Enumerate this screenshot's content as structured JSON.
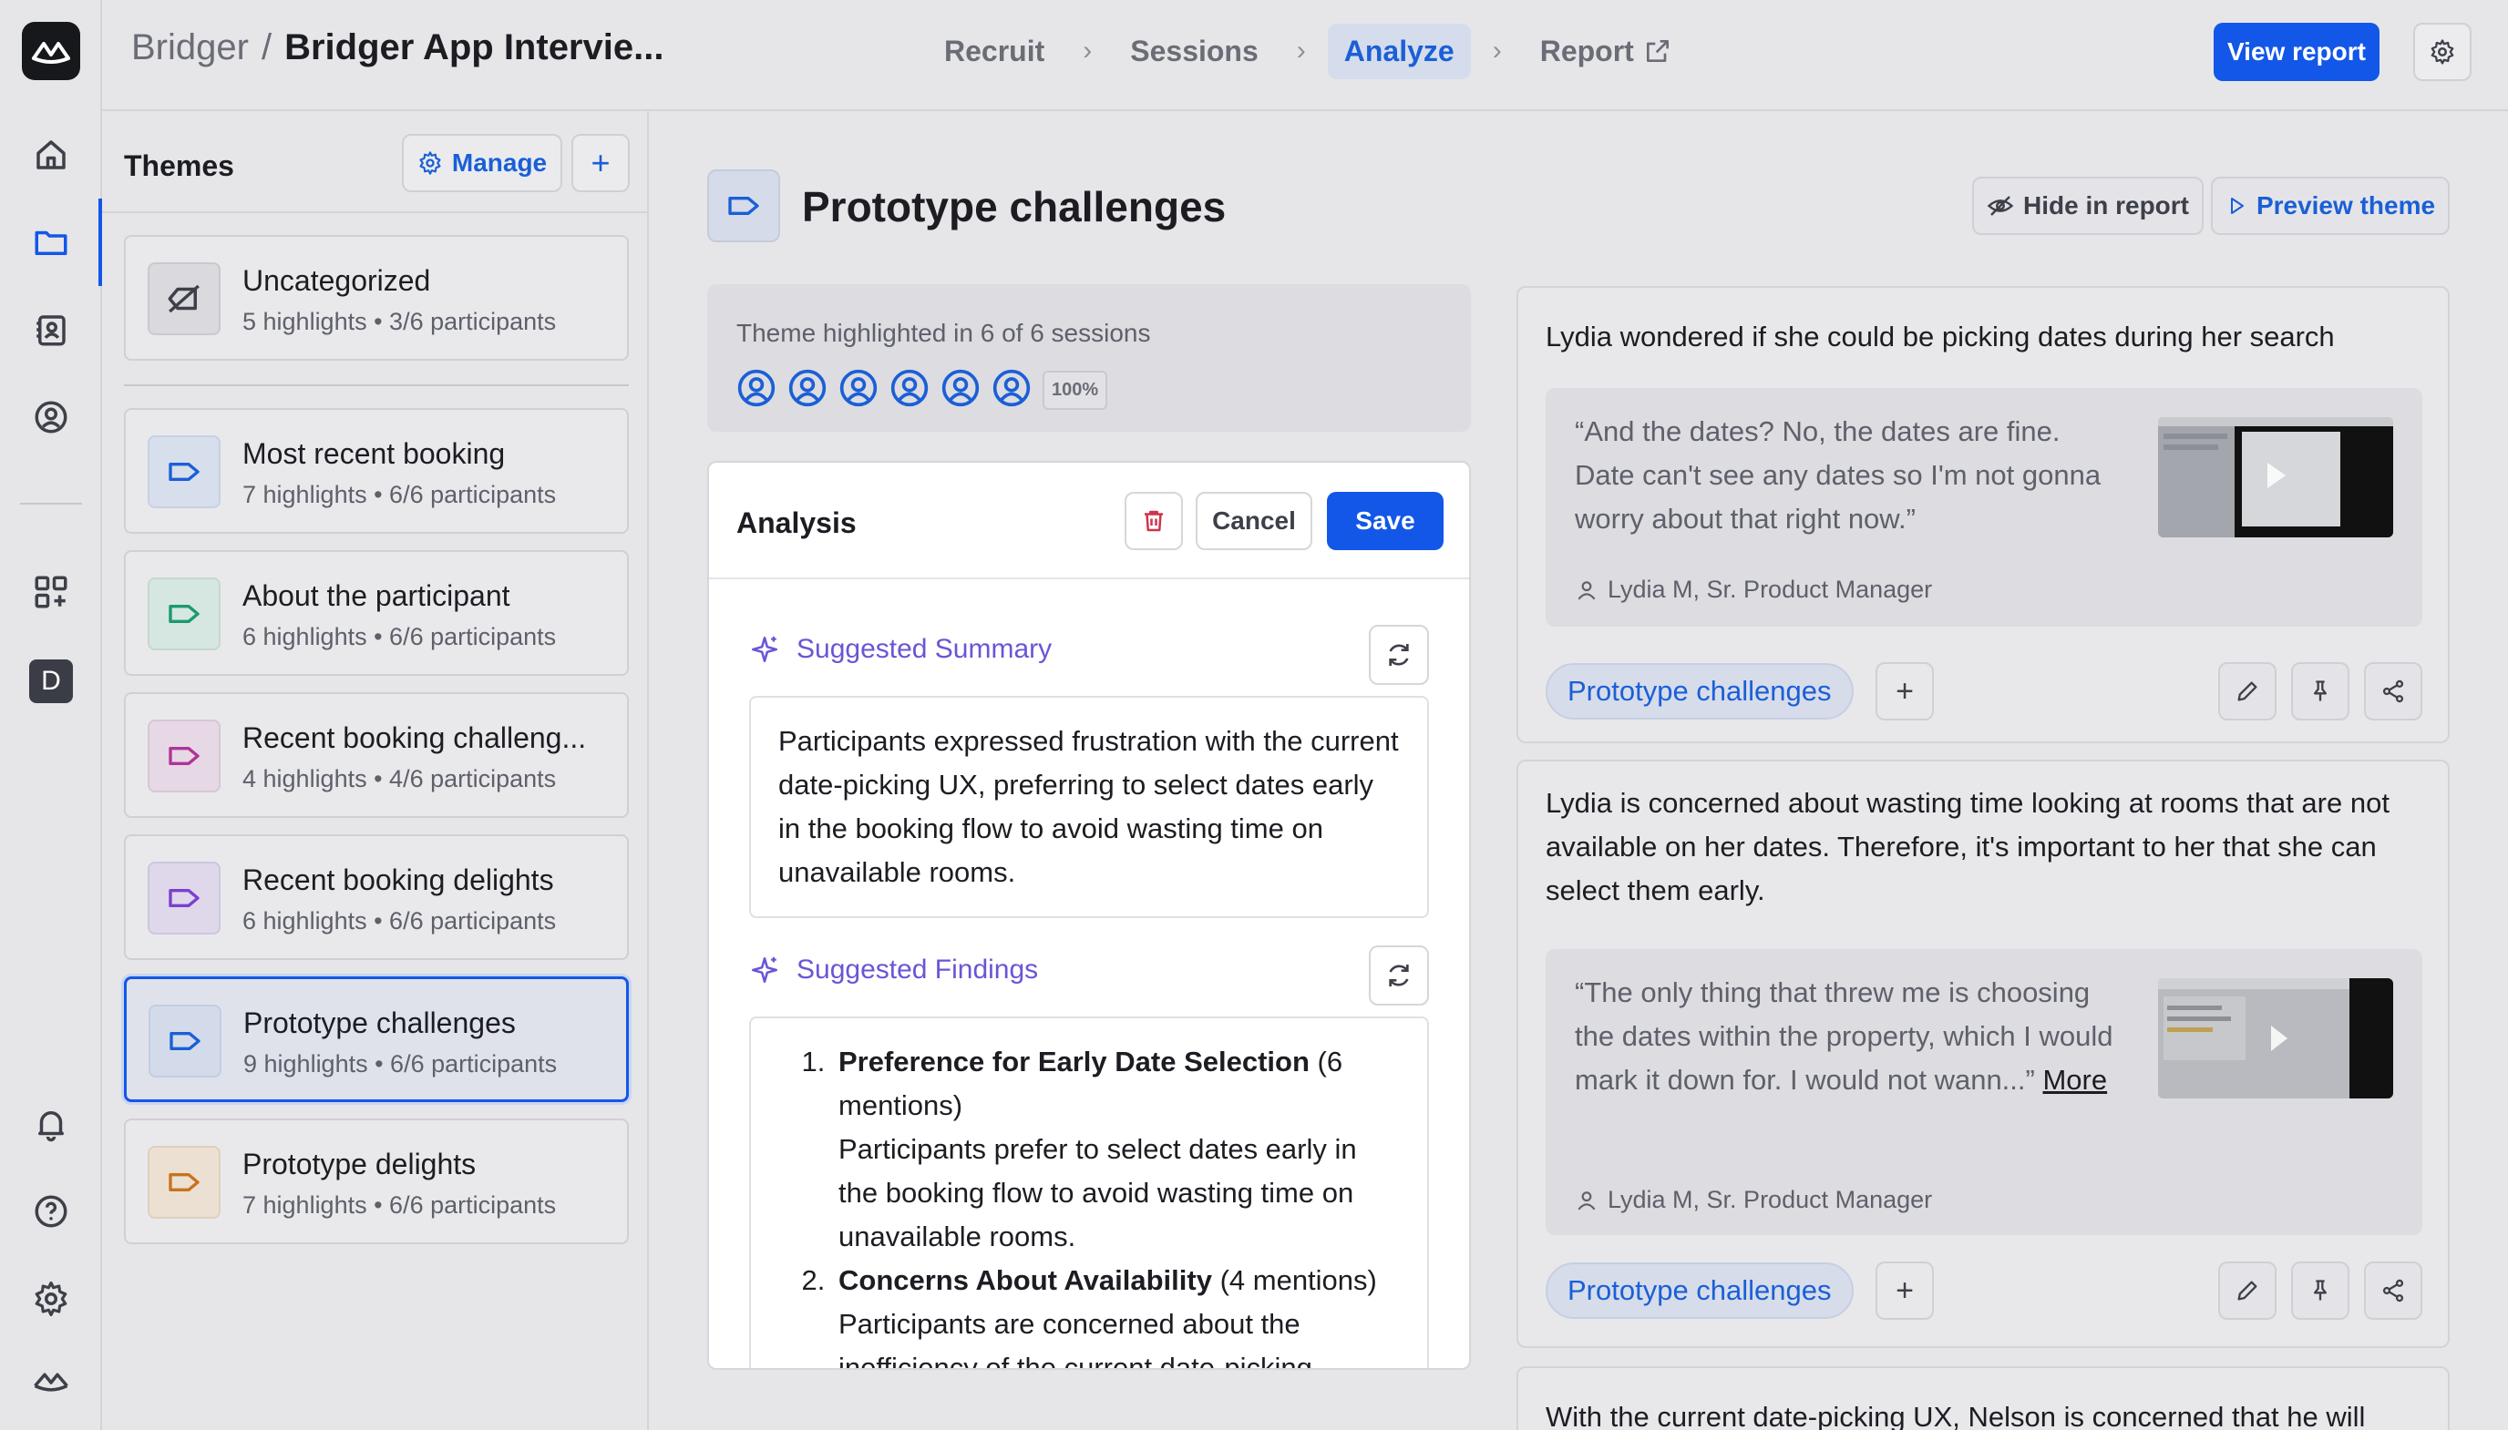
{
  "breadcrumb": {
    "project": "Bridger",
    "separator": "/",
    "current": "Bridger App Intervie..."
  },
  "steps": [
    {
      "label": "Recruit"
    },
    {
      "label": "Sessions"
    },
    {
      "label": "Analyze",
      "active": true
    },
    {
      "label": "Report"
    }
  ],
  "header": {
    "view_report": "View report"
  },
  "themes": {
    "heading": "Themes",
    "manage": "Manage",
    "add": "+",
    "items": [
      {
        "name": "Uncategorized",
        "meta": "5 highlights • 3/6 participants",
        "color": "#3e4049"
      },
      {
        "name": "Most recent booking",
        "meta": "7 highlights • 6/6 participants",
        "color": "#1a5fd6"
      },
      {
        "name": "About the participant",
        "meta": "6 highlights • 6/6 participants",
        "color": "#1a9a6e"
      },
      {
        "name": "Recent booking challeng...",
        "meta": "4 highlights • 4/6 participants",
        "color": "#b0339a"
      },
      {
        "name": "Recent booking delights",
        "meta": "6 highlights • 6/6 participants",
        "color": "#7b3fcf"
      },
      {
        "name": "Prototype challenges",
        "meta": "9 highlights • 6/6 participants",
        "color": "#1a5fd6",
        "selected": true
      },
      {
        "name": "Prototype delights",
        "meta": "7 highlights • 6/6 participants",
        "color": "#c7731c"
      }
    ]
  },
  "main": {
    "title": "Prototype challenges",
    "hide_in_report": "Hide in report",
    "preview_theme": "Preview theme",
    "sessions_text": "Theme highlighted in 6 of 6 sessions",
    "sessions_pct": "100%"
  },
  "analysis": {
    "title": "Analysis",
    "cancel": "Cancel",
    "save": "Save",
    "summary_label": "Suggested Summary",
    "summary_text": "Participants expressed frustration with the current date-picking UX, preferring to select dates early in the booking flow to avoid wasting time on unavailable rooms.",
    "findings_label": "Suggested Findings",
    "findings": [
      {
        "title": "Preference for Early Date Selection",
        "count": "(6 mentions)",
        "text": "Participants prefer to select dates early in the booking flow to avoid wasting time on unavailable rooms."
      },
      {
        "title": "Concerns About Availability",
        "count": "(4 mentions)",
        "text": "Participants are concerned about the inefficiency of the current date-picking"
      }
    ]
  },
  "highlights": [
    {
      "text": "Lydia wondered if she could be picking dates during her search",
      "quote": "“And the dates? No, the dates are fine. Date can't see any dates so I'm not gonna worry about that right now.”",
      "more": "",
      "author": "Lydia M, Sr. Product Manager",
      "tag": "Prototype challenges"
    },
    {
      "text": "Lydia is concerned about wasting time looking at rooms that are not available on her dates. Therefore, it's important to her that she can select them early.",
      "quote": "“The only thing that threw me is choosing the dates within the property, which I would mark it down for. I would not wann...”",
      "more": "More",
      "author": "Lydia M, Sr. Product Manager",
      "tag": "Prototype challenges"
    },
    {
      "text": "With the current date-picking UX, Nelson is concerned that he will"
    }
  ]
}
